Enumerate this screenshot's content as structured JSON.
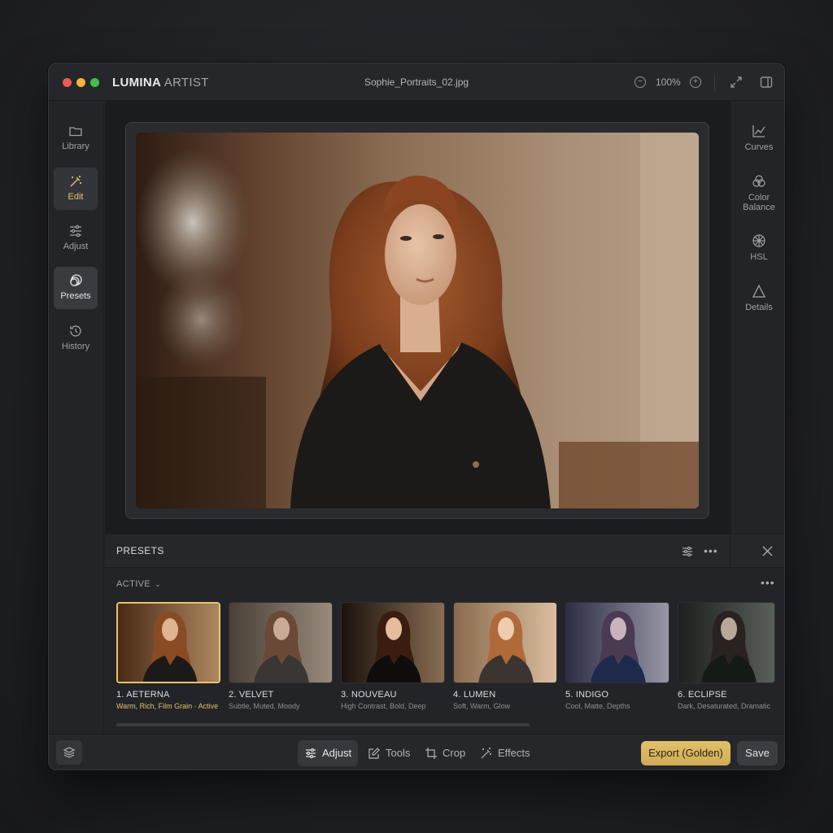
{
  "titlebar": {
    "app_name_bold": "LUMINA",
    "app_name_light": " ARTIST",
    "file_name": "Sophie_Portraits_02.jpg",
    "zoom_level": "100%"
  },
  "left_sidebar": {
    "items": [
      {
        "label": "Library",
        "icon": "folder-icon"
      },
      {
        "label": "Edit",
        "icon": "magic-wand-icon"
      },
      {
        "label": "Adjust",
        "icon": "sliders-icon"
      },
      {
        "label": "Presets",
        "icon": "presets-icon"
      },
      {
        "label": "History",
        "icon": "history-icon"
      }
    ],
    "active": [
      "Edit",
      "Presets"
    ]
  },
  "right_sidebar": {
    "items": [
      {
        "label": "Curves",
        "icon": "curves-icon"
      },
      {
        "label_line1": "Color",
        "label_line2": "Balance",
        "icon": "color-balance-icon"
      },
      {
        "label": "HSL",
        "icon": "hsl-icon"
      },
      {
        "label": "Details",
        "icon": "triangle-icon"
      }
    ]
  },
  "presets_panel": {
    "title": "PRESETS",
    "filter": "ACTIVE",
    "presets": [
      {
        "name": "1. AETERNA",
        "desc": "Warm, Rich, Film Grain · Active",
        "selected": true
      },
      {
        "name": "2. VELVET",
        "desc": "Subtle, Muted, Moody"
      },
      {
        "name": "3. NOUVEAU",
        "desc": "High Contrast, Bold, Deep"
      },
      {
        "name": "4. LUMEN",
        "desc": "Soft, Warm, Glow"
      },
      {
        "name": "5. INDIGO",
        "desc": "Cool, Matte, Depths"
      },
      {
        "name": "6. ECLIPSE",
        "desc": "Dark, Desaturated, Dramatic"
      }
    ]
  },
  "bottom_toolbar": {
    "tools": [
      "Adjust",
      "Tools",
      "Crop",
      "Effects"
    ],
    "active_tool": "Adjust",
    "export_label": "Export (Golden)",
    "save_label": "Save"
  },
  "colors": {
    "accent_gold": "#e2c46a",
    "window_bg": "#232428",
    "canvas_bg": "#1b1c1f"
  }
}
